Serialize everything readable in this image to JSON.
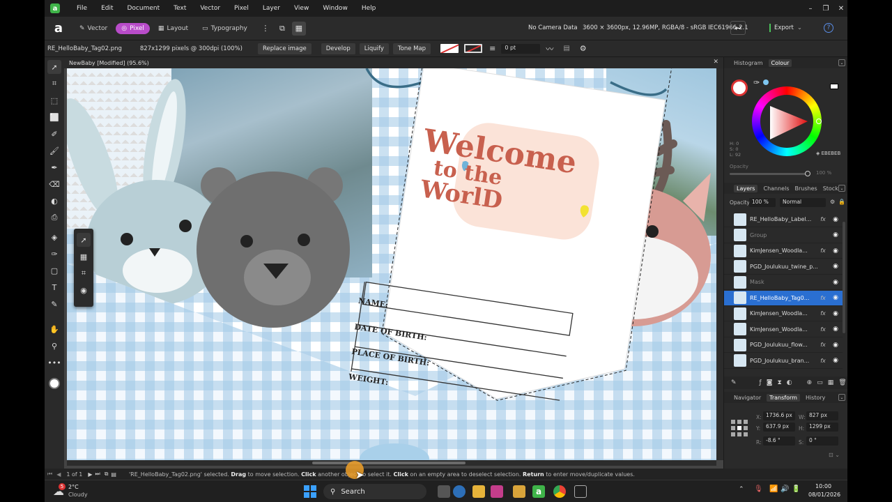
{
  "menubar": {
    "items": [
      "File",
      "Edit",
      "Document",
      "Text",
      "Vector",
      "Pixel",
      "Layer",
      "View",
      "Window",
      "Help"
    ]
  },
  "toolbar": {
    "personas": [
      "Vector",
      "Pixel",
      "Layout",
      "Typography"
    ],
    "active_persona": "Pixel",
    "camera": "No Camera Data",
    "doc_info": "3600 × 3600px, 12.96MP, RGBA/8 - sRGB IEC61966-2.1",
    "export_label": "Export"
  },
  "context": {
    "file": "RE_HelloBaby_Tag02.png",
    "dims": "827x1299 pixels @ 300dpi (100%)",
    "replace": "Replace image",
    "develop": "Develop",
    "liquify": "Liquify",
    "tone_map": "Tone Map",
    "stroke": "0 pt"
  },
  "document": {
    "tab_title": "NewBaby [Modified] (95.6%)",
    "tag_fields": [
      "NAME:",
      "DATE OF BIRTH:",
      "PLACE OF BIRTH:",
      "WEIGHT:"
    ],
    "welcome_lines": [
      "Welcome",
      "to the",
      "WorlD"
    ]
  },
  "panels": {
    "top_tabs": [
      "Histogram",
      "Colour"
    ],
    "hex": "EBEBEB",
    "hsl": [
      "H: 0",
      "S: 0",
      "L: 92"
    ],
    "opacity_label": "Opacity",
    "opacity_value": "100 %",
    "layer_tabs": [
      "Layers",
      "Channels",
      "Brushes",
      "Stock"
    ],
    "layers_opacity_label": "Opacity:",
    "layers_opacity": "100 %",
    "blend": "Normal",
    "layers": [
      {
        "name": "RE_HelloBaby_Label...",
        "fx": "fx",
        "sel": false,
        "dim": false
      },
      {
        "name": "Group",
        "fx": "",
        "sel": false,
        "dim": true
      },
      {
        "name": "KimJensen_Woodla...",
        "fx": "fx",
        "sel": false,
        "dim": false
      },
      {
        "name": "PGD_Joulukuu_twine_p...",
        "fx": "",
        "sel": false,
        "dim": false
      },
      {
        "name": "Mask",
        "fx": "",
        "sel": false,
        "dim": true
      },
      {
        "name": "RE_HelloBaby_Tag0...",
        "fx": "fx",
        "sel": true,
        "dim": false
      },
      {
        "name": "KimJensen_Woodla...",
        "fx": "fx",
        "sel": false,
        "dim": false
      },
      {
        "name": "KimJensen_Woodla...",
        "fx": "fx",
        "sel": false,
        "dim": false
      },
      {
        "name": "PGD_Joulukuu_flow...",
        "fx": "fx",
        "sel": false,
        "dim": false
      },
      {
        "name": "PGD_Joulukuu_bran...",
        "fx": "fx",
        "sel": false,
        "dim": false
      }
    ],
    "transform_tabs": [
      "Navigator",
      "Transform",
      "History"
    ],
    "transform": {
      "x": "1736.6 px",
      "y": "637.9 px",
      "w": "827 px",
      "h": "1299 px",
      "r": "-8.6 °",
      "s": "0 °"
    }
  },
  "status": {
    "pages": "1 of 1",
    "msg_file": "'RE_HelloBaby_Tag02.png' selected. ",
    "drag": "Drag",
    "drag_rest": " to move selection. ",
    "click1": "Click",
    "click1_rest": " another object to select it. ",
    "click2": "Click",
    "click2_rest": " on an empty area to deselect selection. ",
    "ret": "Return",
    "ret_rest": " to enter move/duplicate values."
  },
  "taskbar": {
    "temp": "2°C",
    "weather": "Cloudy",
    "badge": "5",
    "search": "Search",
    "time": "10:00",
    "date": "08/01/2026"
  },
  "colors": {
    "accent_blue": "#2a6fd1",
    "persona_pink": "#b84cc9",
    "export_green": "#49c25a"
  }
}
